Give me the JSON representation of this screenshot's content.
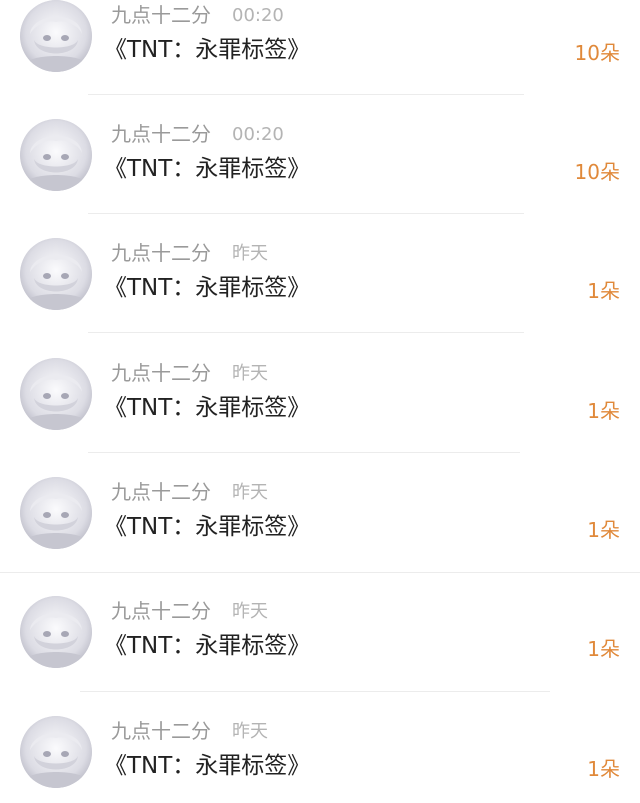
{
  "gifts": [
    {
      "sender": "九点十二分",
      "time": "00:20",
      "book": "《TNT：永罪标签》",
      "amount": "10朵",
      "avatar_icon": "anime-avatar-icon"
    },
    {
      "sender": "九点十二分",
      "time": "00:20",
      "book": "《TNT：永罪标签》",
      "amount": "10朵",
      "avatar_icon": "anime-avatar-icon"
    },
    {
      "sender": "九点十二分",
      "time": "昨天",
      "book": "《TNT：永罪标签》",
      "amount": "1朵",
      "avatar_icon": "anime-avatar-icon"
    },
    {
      "sender": "九点十二分",
      "time": "昨天",
      "book": "《TNT：永罪标签》",
      "amount": "1朵",
      "avatar_icon": "anime-avatar-icon"
    },
    {
      "sender": "九点十二分",
      "time": "昨天",
      "book": "《TNT：永罪标签》",
      "amount": "1朵",
      "avatar_icon": "anime-avatar-icon"
    },
    {
      "sender": "九点十二分",
      "time": "昨天",
      "book": "《TNT：永罪标签》",
      "amount": "1朵",
      "avatar_icon": "anime-avatar-icon"
    },
    {
      "sender": "九点十二分",
      "time": "昨天",
      "book": "《TNT：永罪标签》",
      "amount": "1朵",
      "avatar_icon": "anime-avatar-icon"
    }
  ],
  "colors": {
    "amount": "#e0893a",
    "name": "#9a9a9a",
    "time": "#b4b4b4",
    "title": "#222222",
    "divider": "#ececec"
  }
}
